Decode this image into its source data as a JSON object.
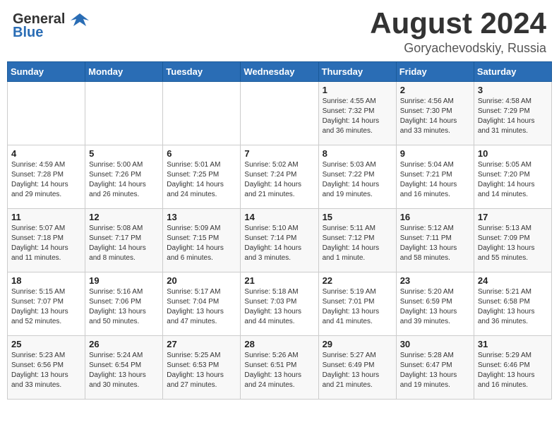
{
  "header": {
    "logo_line1": "General",
    "logo_line2": "Blue",
    "month": "August 2024",
    "location": "Goryachevodskiy, Russia"
  },
  "weekdays": [
    "Sunday",
    "Monday",
    "Tuesday",
    "Wednesday",
    "Thursday",
    "Friday",
    "Saturday"
  ],
  "weeks": [
    [
      {
        "day": "",
        "info": ""
      },
      {
        "day": "",
        "info": ""
      },
      {
        "day": "",
        "info": ""
      },
      {
        "day": "",
        "info": ""
      },
      {
        "day": "1",
        "info": "Sunrise: 4:55 AM\nSunset: 7:32 PM\nDaylight: 14 hours\nand 36 minutes."
      },
      {
        "day": "2",
        "info": "Sunrise: 4:56 AM\nSunset: 7:30 PM\nDaylight: 14 hours\nand 33 minutes."
      },
      {
        "day": "3",
        "info": "Sunrise: 4:58 AM\nSunset: 7:29 PM\nDaylight: 14 hours\nand 31 minutes."
      }
    ],
    [
      {
        "day": "4",
        "info": "Sunrise: 4:59 AM\nSunset: 7:28 PM\nDaylight: 14 hours\nand 29 minutes."
      },
      {
        "day": "5",
        "info": "Sunrise: 5:00 AM\nSunset: 7:26 PM\nDaylight: 14 hours\nand 26 minutes."
      },
      {
        "day": "6",
        "info": "Sunrise: 5:01 AM\nSunset: 7:25 PM\nDaylight: 14 hours\nand 24 minutes."
      },
      {
        "day": "7",
        "info": "Sunrise: 5:02 AM\nSunset: 7:24 PM\nDaylight: 14 hours\nand 21 minutes."
      },
      {
        "day": "8",
        "info": "Sunrise: 5:03 AM\nSunset: 7:22 PM\nDaylight: 14 hours\nand 19 minutes."
      },
      {
        "day": "9",
        "info": "Sunrise: 5:04 AM\nSunset: 7:21 PM\nDaylight: 14 hours\nand 16 minutes."
      },
      {
        "day": "10",
        "info": "Sunrise: 5:05 AM\nSunset: 7:20 PM\nDaylight: 14 hours\nand 14 minutes."
      }
    ],
    [
      {
        "day": "11",
        "info": "Sunrise: 5:07 AM\nSunset: 7:18 PM\nDaylight: 14 hours\nand 11 minutes."
      },
      {
        "day": "12",
        "info": "Sunrise: 5:08 AM\nSunset: 7:17 PM\nDaylight: 14 hours\nand 8 minutes."
      },
      {
        "day": "13",
        "info": "Sunrise: 5:09 AM\nSunset: 7:15 PM\nDaylight: 14 hours\nand 6 minutes."
      },
      {
        "day": "14",
        "info": "Sunrise: 5:10 AM\nSunset: 7:14 PM\nDaylight: 14 hours\nand 3 minutes."
      },
      {
        "day": "15",
        "info": "Sunrise: 5:11 AM\nSunset: 7:12 PM\nDaylight: 14 hours\nand 1 minute."
      },
      {
        "day": "16",
        "info": "Sunrise: 5:12 AM\nSunset: 7:11 PM\nDaylight: 13 hours\nand 58 minutes."
      },
      {
        "day": "17",
        "info": "Sunrise: 5:13 AM\nSunset: 7:09 PM\nDaylight: 13 hours\nand 55 minutes."
      }
    ],
    [
      {
        "day": "18",
        "info": "Sunrise: 5:15 AM\nSunset: 7:07 PM\nDaylight: 13 hours\nand 52 minutes."
      },
      {
        "day": "19",
        "info": "Sunrise: 5:16 AM\nSunset: 7:06 PM\nDaylight: 13 hours\nand 50 minutes."
      },
      {
        "day": "20",
        "info": "Sunrise: 5:17 AM\nSunset: 7:04 PM\nDaylight: 13 hours\nand 47 minutes."
      },
      {
        "day": "21",
        "info": "Sunrise: 5:18 AM\nSunset: 7:03 PM\nDaylight: 13 hours\nand 44 minutes."
      },
      {
        "day": "22",
        "info": "Sunrise: 5:19 AM\nSunset: 7:01 PM\nDaylight: 13 hours\nand 41 minutes."
      },
      {
        "day": "23",
        "info": "Sunrise: 5:20 AM\nSunset: 6:59 PM\nDaylight: 13 hours\nand 39 minutes."
      },
      {
        "day": "24",
        "info": "Sunrise: 5:21 AM\nSunset: 6:58 PM\nDaylight: 13 hours\nand 36 minutes."
      }
    ],
    [
      {
        "day": "25",
        "info": "Sunrise: 5:23 AM\nSunset: 6:56 PM\nDaylight: 13 hours\nand 33 minutes."
      },
      {
        "day": "26",
        "info": "Sunrise: 5:24 AM\nSunset: 6:54 PM\nDaylight: 13 hours\nand 30 minutes."
      },
      {
        "day": "27",
        "info": "Sunrise: 5:25 AM\nSunset: 6:53 PM\nDaylight: 13 hours\nand 27 minutes."
      },
      {
        "day": "28",
        "info": "Sunrise: 5:26 AM\nSunset: 6:51 PM\nDaylight: 13 hours\nand 24 minutes."
      },
      {
        "day": "29",
        "info": "Sunrise: 5:27 AM\nSunset: 6:49 PM\nDaylight: 13 hours\nand 21 minutes."
      },
      {
        "day": "30",
        "info": "Sunrise: 5:28 AM\nSunset: 6:47 PM\nDaylight: 13 hours\nand 19 minutes."
      },
      {
        "day": "31",
        "info": "Sunrise: 5:29 AM\nSunset: 6:46 PM\nDaylight: 13 hours\nand 16 minutes."
      }
    ]
  ]
}
